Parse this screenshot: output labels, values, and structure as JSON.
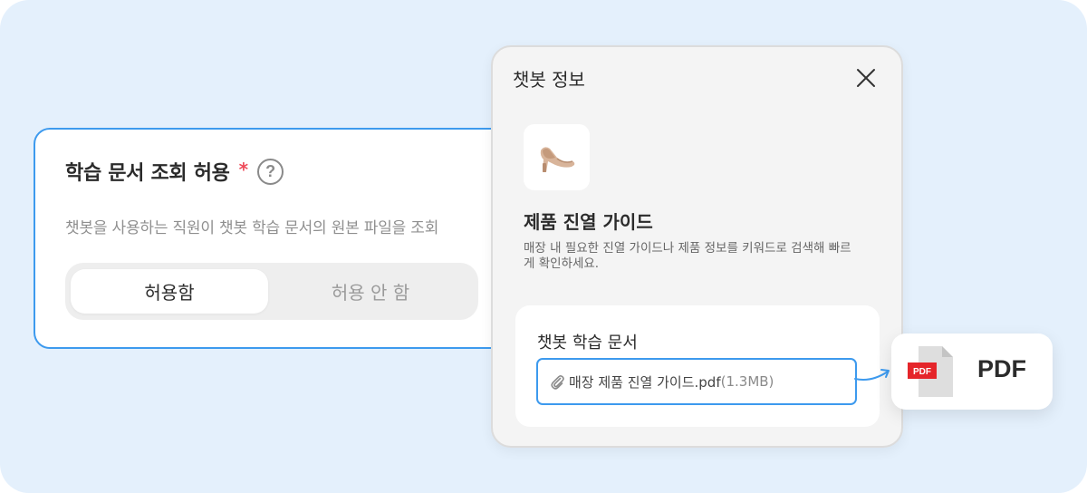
{
  "setting": {
    "title": "학습 문서 조회 허용",
    "required_mark": "*",
    "help_icon_glyph": "?",
    "description": "챗봇을 사용하는 직원이 챗봇 학습 문서의 원본 파일을 조회",
    "options": [
      {
        "label": "허용함",
        "selected": true
      },
      {
        "label": "허용 안 함",
        "selected": false
      }
    ]
  },
  "panel": {
    "title": "챗봇 정보",
    "close_icon": "close-icon",
    "avatar_icon": "heel-shoe-icon",
    "bot_name": "제품 진열 가이드",
    "bot_description": "매장 내 필요한 진열 가이드나 제품 정보를 키워드로 검색해 빠르게 확인하세요.",
    "docs_label": "챗봇 학습 문서",
    "file": {
      "icon": "paperclip-icon",
      "name": "매장 제품 진열 가이드.pdf",
      "size": "(1.3MB)"
    }
  },
  "pdf_badge": {
    "icon": "pdf-file-icon",
    "icon_text": "PDF",
    "label": "PDF"
  },
  "colors": {
    "background": "#e4f0fc",
    "accent": "#3d9aee",
    "required": "#ee4b5a",
    "pdf_red": "#e5252a"
  }
}
